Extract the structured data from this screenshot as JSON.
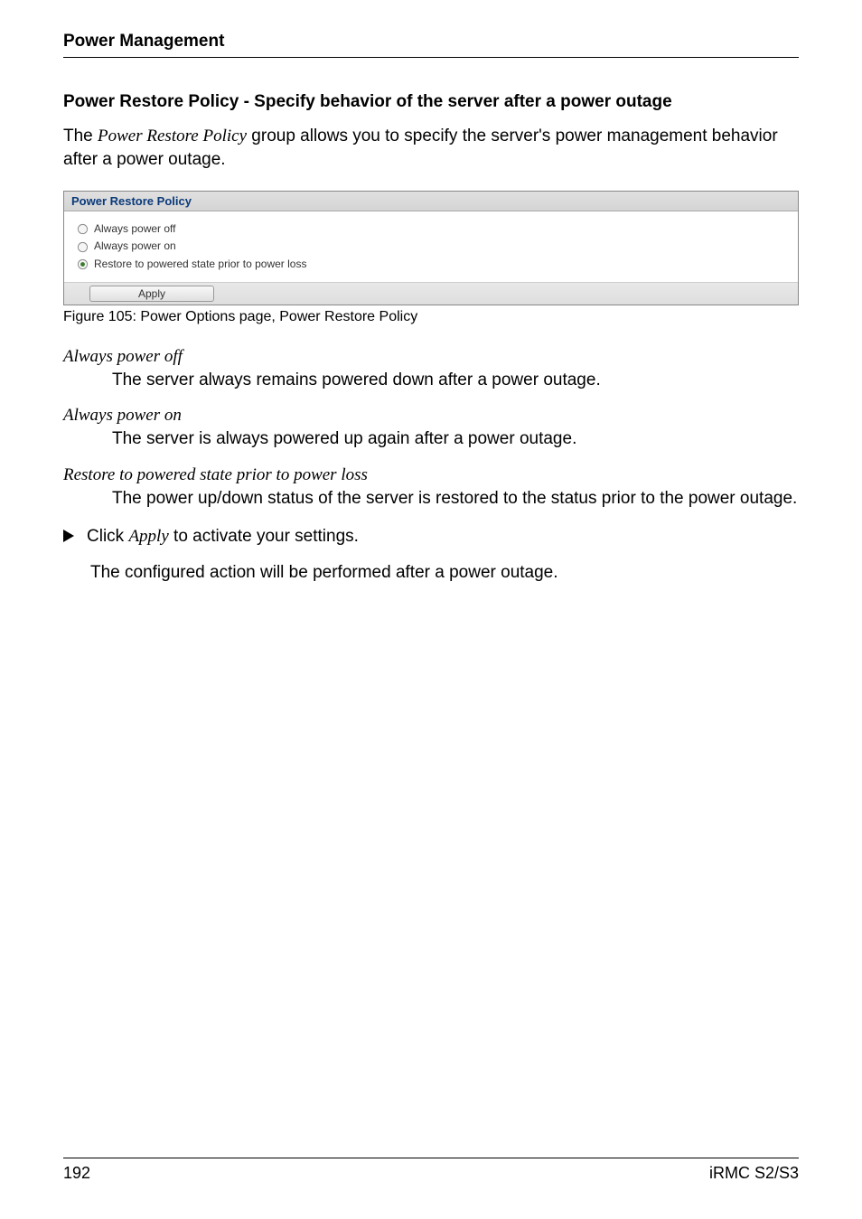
{
  "header": {
    "section_title": "Power Management"
  },
  "content": {
    "subsection_title": "Power Restore Policy - Specify behavior of the server after a power outage",
    "intro_prefix": "The ",
    "intro_italic": "Power Restore Policy",
    "intro_suffix": " group allows you to specify the server's power management behavior after a power outage."
  },
  "panel": {
    "title": "Power Restore Policy",
    "options": {
      "opt1": "Always power off",
      "opt2": "Always power on",
      "opt3": "Restore to powered state prior to power loss"
    },
    "apply_label": "Apply"
  },
  "figure_caption": "Figure 105: Power Options page, Power Restore Policy",
  "definitions": {
    "term1": "Always power off",
    "body1": "The server always remains powered down after a power outage.",
    "term2": "Always power on",
    "body2": "The server is always powered up again after a power outage.",
    "term3": "Restore to powered state prior to power loss",
    "body3": "The power up/down status of the server is restored to the status prior to the power outage."
  },
  "instruction": {
    "click_prefix": "Click ",
    "click_italic": "Apply",
    "click_suffix": " to activate your settings.",
    "result": "The configured action will be performed after a power outage."
  },
  "footer": {
    "page_number": "192",
    "doc_ref": "iRMC S2/S3"
  }
}
